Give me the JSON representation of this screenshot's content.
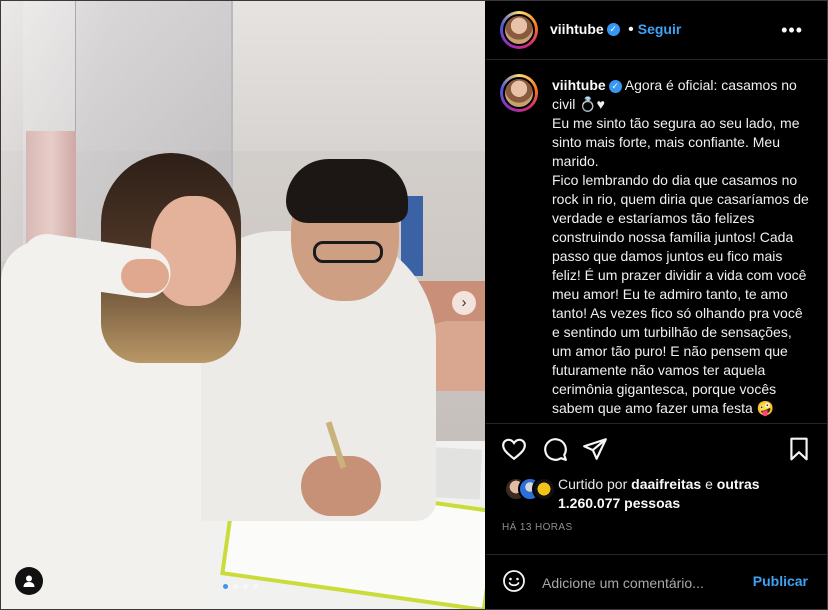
{
  "post": {
    "username": "viihtube",
    "verified_icon": "verified-badge-icon",
    "separator": "•",
    "follow_label": "Seguir",
    "more_icon": "more-horizontal-icon",
    "caption_text": "Agora é oficial: casamos no civil 💍♥\nEu me sinto tão segura ao seu lado, me sinto mais forte, mais confiante. Meu marido.\nFico lembrando do dia que casamos no rock in rio, quem diria que casaríamos de verdade e estaríamos tão felizes construindo nossa família juntos! Cada passo que damos juntos eu fico mais feliz! É um prazer dividir a vida com você meu amor! Eu te admiro tanto, te amo tanto! As vezes fico só olhando pra você e sentindo um turbilhão de sensações, um amor tão puro! E não pensem que futuramente não vamos ter aquela cerimônia gigantesca, porque vocês sabem que amo fazer uma festa 🤪"
  },
  "photo": {
    "next_icon": "chevron-right-icon",
    "user_tag_icon": "user-tag-icon",
    "carousel_dots": 4,
    "carousel_active_index": 0
  },
  "actions": {
    "like_icon": "heart-icon",
    "comment_icon": "comment-icon",
    "share_icon": "share-icon",
    "save_icon": "bookmark-icon"
  },
  "likes": {
    "prefix": "Curtido por",
    "user": "daaifreitas",
    "connector": "e",
    "others": "outras 1.260.077 pessoas"
  },
  "timestamp": "HÁ 13 HORAS",
  "comment": {
    "emoji_icon": "emoji-icon",
    "placeholder": "Adicione um comentário...",
    "publish_label": "Publicar"
  },
  "colors": {
    "accent": "#3ea2f5",
    "background": "#000000",
    "divider": "#262626"
  }
}
